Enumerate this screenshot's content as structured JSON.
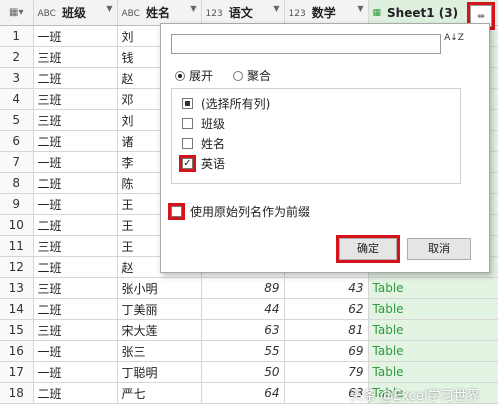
{
  "columns": [
    {
      "type": "ABC",
      "name": "班级"
    },
    {
      "type": "ABC",
      "name": "姓名"
    },
    {
      "type": "123",
      "name": "语文"
    },
    {
      "type": "123",
      "name": "数学"
    },
    {
      "type": "table",
      "name": "Sheet1 (3)"
    }
  ],
  "rows": [
    {
      "idx": "1",
      "c1": "一班",
      "c2": "刘",
      "c3": "",
      "c4": "",
      "c5": ""
    },
    {
      "idx": "2",
      "c1": "三班",
      "c2": "钱",
      "c3": "",
      "c4": "",
      "c5": ""
    },
    {
      "idx": "3",
      "c1": "二班",
      "c2": "赵",
      "c3": "",
      "c4": "",
      "c5": ""
    },
    {
      "idx": "4",
      "c1": "三班",
      "c2": "邓",
      "c3": "",
      "c4": "",
      "c5": ""
    },
    {
      "idx": "5",
      "c1": "三班",
      "c2": "刘",
      "c3": "",
      "c4": "",
      "c5": ""
    },
    {
      "idx": "6",
      "c1": "二班",
      "c2": "诸",
      "c3": "",
      "c4": "",
      "c5": ""
    },
    {
      "idx": "7",
      "c1": "一班",
      "c2": "李",
      "c3": "",
      "c4": "",
      "c5": ""
    },
    {
      "idx": "8",
      "c1": "二班",
      "c2": "陈",
      "c3": "",
      "c4": "",
      "c5": ""
    },
    {
      "idx": "9",
      "c1": "一班",
      "c2": "王",
      "c3": "",
      "c4": "",
      "c5": ""
    },
    {
      "idx": "10",
      "c1": "二班",
      "c2": "王",
      "c3": "",
      "c4": "",
      "c5": ""
    },
    {
      "idx": "11",
      "c1": "三班",
      "c2": "王",
      "c3": "",
      "c4": "",
      "c5": ""
    },
    {
      "idx": "12",
      "c1": "二班",
      "c2": "赵",
      "c3": "",
      "c4": "",
      "c5": ""
    },
    {
      "idx": "13",
      "c1": "三班",
      "c2": "张小明",
      "c3": "89",
      "c4": "43",
      "c5": "Table"
    },
    {
      "idx": "14",
      "c1": "二班",
      "c2": "丁美丽",
      "c3": "44",
      "c4": "62",
      "c5": "Table"
    },
    {
      "idx": "15",
      "c1": "三班",
      "c2": "宋大莲",
      "c3": "63",
      "c4": "81",
      "c5": "Table"
    },
    {
      "idx": "16",
      "c1": "一班",
      "c2": "张三",
      "c3": "55",
      "c4": "69",
      "c5": "Table"
    },
    {
      "idx": "17",
      "c1": "一班",
      "c2": "丁聪明",
      "c3": "50",
      "c4": "79",
      "c5": "Table"
    },
    {
      "idx": "18",
      "c1": "二班",
      "c2": "严七",
      "c3": "64",
      "c4": "63",
      "c5": "Table"
    }
  ],
  "popup": {
    "search_placeholder": "",
    "sort_icon": "A↓Z",
    "radio_expand": "展开",
    "radio_aggregate": "聚合",
    "options": [
      {
        "label": "(选择所有列)",
        "state": "partial"
      },
      {
        "label": "班级",
        "state": "unchecked"
      },
      {
        "label": "姓名",
        "state": "unchecked"
      },
      {
        "label": "英语",
        "state": "checked"
      }
    ],
    "prefix_label": "使用原始列名作为前缀",
    "ok_label": "确定",
    "cancel_label": "取消"
  },
  "watermark": "头条 @Excel学习世界",
  "colors": {
    "highlight": "#d3141b",
    "table_text": "#2f9a3e",
    "table_bg": "#e3f4e3"
  }
}
